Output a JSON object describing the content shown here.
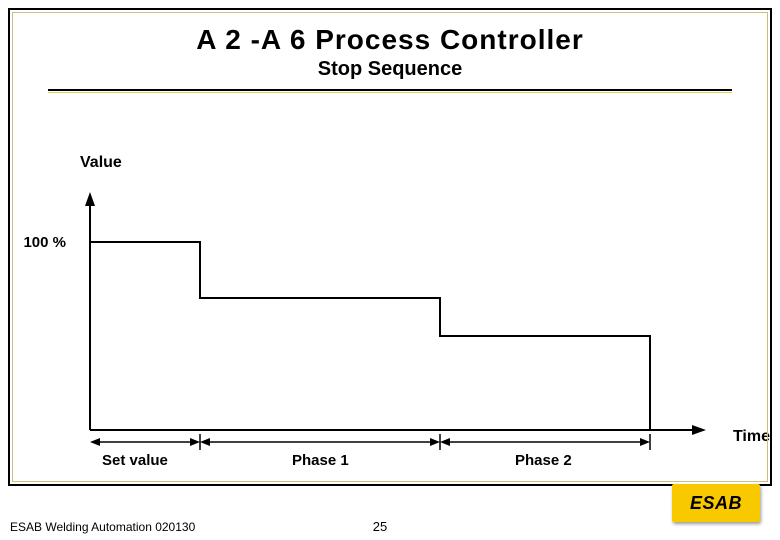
{
  "title": "A 2 -A 6 Process Controller",
  "subtitle": "Stop Sequence",
  "chart_data": {
    "type": "bar",
    "title": "Stop Sequence",
    "xlabel": "Time",
    "ylabel": "Value",
    "ylim": [
      0,
      100
    ],
    "categories": [
      "Set value",
      "Phase 1",
      "Phase 2"
    ],
    "values": [
      100,
      70,
      50
    ],
    "y_tick_label": "100 %"
  },
  "phase_labels": {
    "set_value": "Set value",
    "phase1": "Phase 1",
    "phase2": "Phase 2"
  },
  "axis": {
    "y_label": "Value",
    "x_label": "Time",
    "y_tick": "100 %"
  },
  "footer": "ESAB Welding Automation 020130",
  "page_number": "25",
  "logo_text": "ESAB"
}
